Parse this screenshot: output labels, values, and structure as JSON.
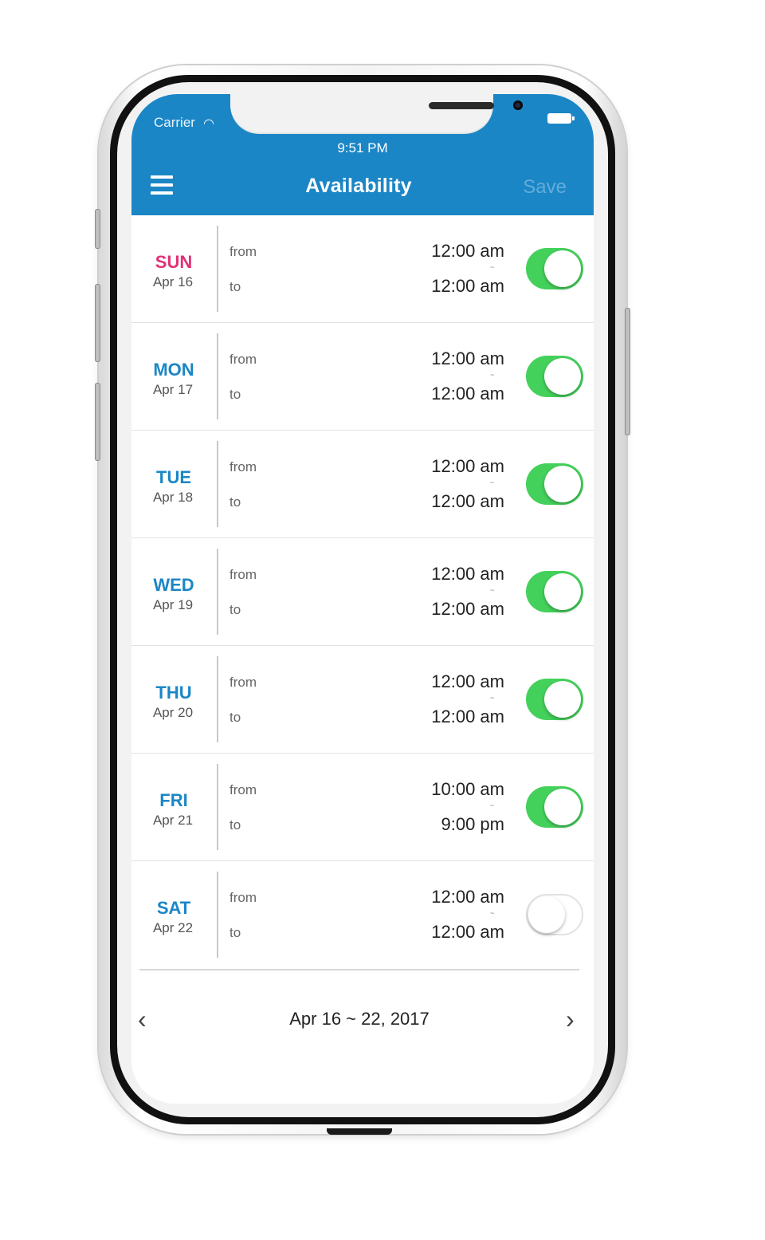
{
  "status_bar": {
    "carrier": "Carrier",
    "time": "9:51 PM"
  },
  "nav": {
    "title": "Availability",
    "save_label": "Save"
  },
  "labels": {
    "from": "from",
    "to": "to"
  },
  "days": [
    {
      "name": "SUN",
      "date": "Apr 16",
      "from": "12:00 am",
      "to": "12:00 am",
      "enabled": true
    },
    {
      "name": "MON",
      "date": "Apr 17",
      "from": "12:00 am",
      "to": "12:00 am",
      "enabled": true
    },
    {
      "name": "TUE",
      "date": "Apr 18",
      "from": "12:00 am",
      "to": "12:00 am",
      "enabled": true
    },
    {
      "name": "WED",
      "date": "Apr 19",
      "from": "12:00 am",
      "to": "12:00 am",
      "enabled": true
    },
    {
      "name": "THU",
      "date": "Apr 20",
      "from": "12:00 am",
      "to": "12:00 am",
      "enabled": true
    },
    {
      "name": "FRI",
      "date": "Apr 21",
      "from": "10:00 am",
      "to": "9:00 pm",
      "enabled": true
    },
    {
      "name": "SAT",
      "date": "Apr 22",
      "from": "12:00 am",
      "to": "12:00 am",
      "enabled": false
    }
  ],
  "footer": {
    "week_range": "Apr 16 ~ 22, 2017",
    "prev_icon": "chevron-left-icon",
    "next_icon": "chevron-right-icon"
  },
  "colors": {
    "accent": "#1b86c6",
    "sunday": "#e23177",
    "toggle_on": "#44d15b"
  }
}
